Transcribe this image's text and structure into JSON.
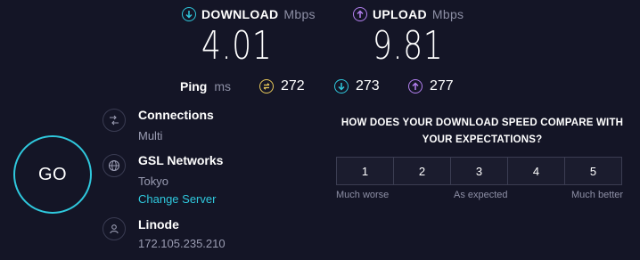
{
  "download": {
    "label": "DOWNLOAD",
    "unit": "Mbps",
    "value": "4.01",
    "icon": "download-arrow-icon",
    "color": "#2fc8dd"
  },
  "upload": {
    "label": "UPLOAD",
    "unit": "Mbps",
    "value": "9.81",
    "icon": "upload-arrow-icon",
    "color": "#b380f0"
  },
  "ping": {
    "label": "Ping",
    "unit": "ms",
    "idle": {
      "value": "272",
      "icon": "idle-latency-icon",
      "color": "#e8c85a"
    },
    "download": {
      "value": "273",
      "icon": "download-latency-icon",
      "color": "#2fc8dd"
    },
    "upload": {
      "value": "277",
      "icon": "upload-latency-icon",
      "color": "#b380f0"
    }
  },
  "go_button": {
    "label": "GO"
  },
  "connections": {
    "title": "Connections",
    "value": "Multi",
    "icon": "connections-icon"
  },
  "server": {
    "title": "GSL Networks",
    "location": "Tokyo",
    "change_link": "Change Server",
    "icon": "globe-icon"
  },
  "provider": {
    "title": "Linode",
    "ip": "172.105.235.210",
    "icon": "user-icon"
  },
  "survey": {
    "question": "HOW DOES YOUR DOWNLOAD SPEED COMPARE WITH YOUR EXPECTATIONS?",
    "options": [
      "1",
      "2",
      "3",
      "4",
      "5"
    ],
    "labels": {
      "low": "Much worse",
      "mid": "As expected",
      "high": "Much better"
    }
  }
}
